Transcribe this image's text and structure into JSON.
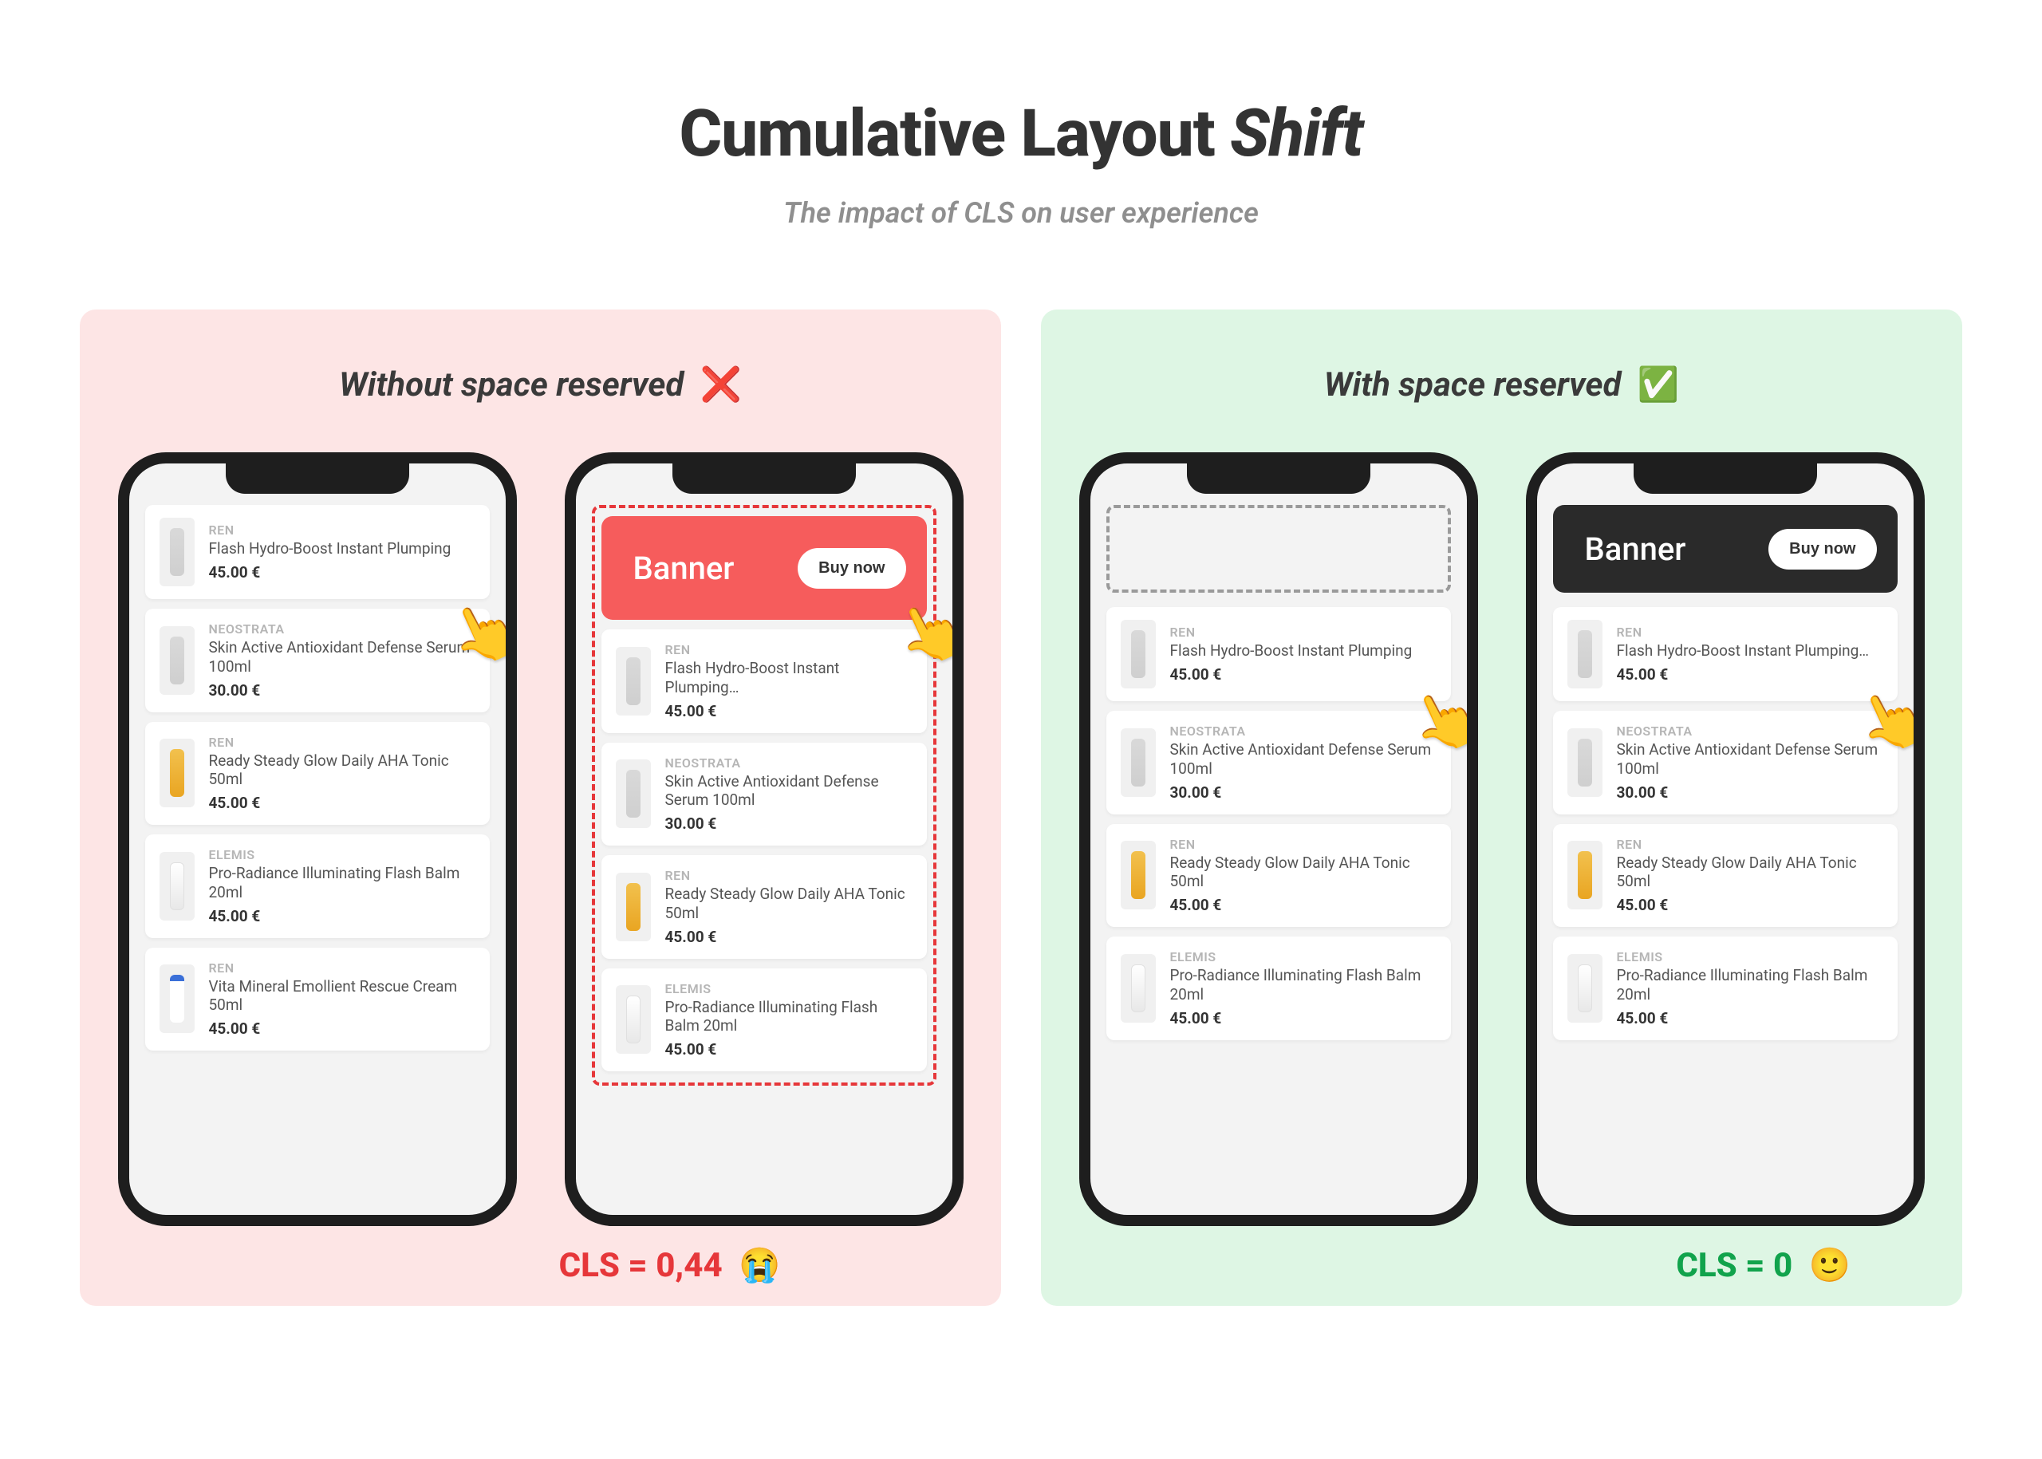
{
  "title_plain": "Cumulative Layout ",
  "title_italic": "Shift",
  "subtitle": "The impact of CLS on user experience",
  "panel_bad": {
    "heading": "Without space reserved",
    "heading_icon": "❌",
    "cls_label": "CLS = 0,44",
    "cls_emoji": "😭"
  },
  "panel_good": {
    "heading": "With space reserved",
    "heading_icon": "✅",
    "cls_label": "CLS = 0",
    "cls_emoji": "🙂"
  },
  "banner": {
    "label": "Banner",
    "cta": "Buy now"
  },
  "products": [
    {
      "brand": "REN",
      "name": "Flash Hydro-Boost Instant Plumping",
      "price": "45.00 €",
      "thumb": "grey"
    },
    {
      "brand": "NEOSTRATA",
      "name": "Skin Active Antioxidant Defense Serum 100ml",
      "price": "30.00 €",
      "thumb": "grey"
    },
    {
      "brand": "REN",
      "name": "Ready Steady Glow Daily AHA Tonic 50ml",
      "price": "45.00 €",
      "thumb": "amber"
    },
    {
      "brand": "ELEMIS",
      "name": "Pro-Radiance Illuminating Flash Balm 20ml",
      "price": "45.00 €",
      "thumb": "white"
    },
    {
      "brand": "REN",
      "name": "Vita Mineral Emollient Rescue Cream 50ml",
      "price": "45.00 €",
      "thumb": "blue"
    }
  ],
  "product_truncated_name": "Flash Hydro-Boost Instant Plumping…",
  "hand_emoji": "👆"
}
